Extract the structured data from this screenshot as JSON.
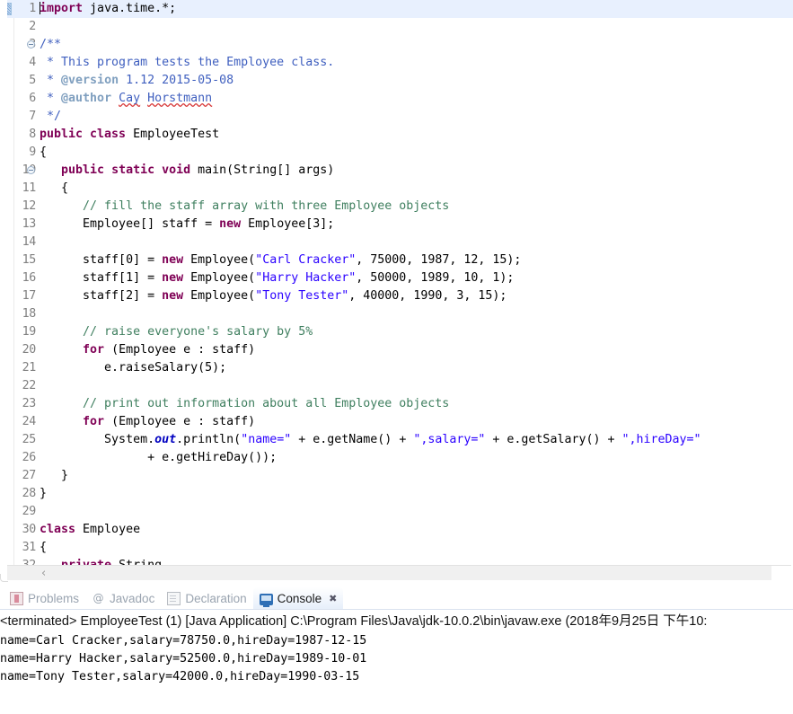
{
  "editor": {
    "name": "java-source-editor",
    "current_line": 1,
    "caret_line": 1,
    "fold_lines": [
      3,
      10
    ],
    "scrollbar": {
      "left_arrow_glyph": "‹"
    },
    "lines": [
      {
        "n": 1,
        "tokens": [
          {
            "t": "caret",
            "v": ""
          },
          {
            "t": "kw",
            "v": "import"
          },
          {
            "t": "plain",
            "v": " java.time.*;"
          }
        ]
      },
      {
        "n": 2,
        "tokens": []
      },
      {
        "n": 3,
        "tokens": [
          {
            "t": "jdoc",
            "v": "/**"
          }
        ]
      },
      {
        "n": 4,
        "tokens": [
          {
            "t": "jdoc",
            "v": " * This program tests the Employee class."
          }
        ]
      },
      {
        "n": 5,
        "tokens": [
          {
            "t": "jdoc",
            "v": " * "
          },
          {
            "t": "jtag",
            "v": "@version"
          },
          {
            "t": "jdoc",
            "v": " 1.12 2015-05-08"
          }
        ]
      },
      {
        "n": 6,
        "tokens": [
          {
            "t": "jdoc",
            "v": " * "
          },
          {
            "t": "jtag",
            "v": "@author"
          },
          {
            "t": "jdoc",
            "v": " "
          },
          {
            "t": "jdoc spell",
            "v": "Cay"
          },
          {
            "t": "jdoc",
            "v": " "
          },
          {
            "t": "jdoc spell",
            "v": "Horstmann"
          }
        ]
      },
      {
        "n": 7,
        "tokens": [
          {
            "t": "jdoc",
            "v": " */"
          }
        ]
      },
      {
        "n": 8,
        "tokens": [
          {
            "t": "kw",
            "v": "public class"
          },
          {
            "t": "plain",
            "v": " EmployeeTest"
          }
        ]
      },
      {
        "n": 9,
        "tokens": [
          {
            "t": "plain",
            "v": "{"
          }
        ]
      },
      {
        "n": 10,
        "tokens": [
          {
            "t": "plain",
            "v": "   "
          },
          {
            "t": "kw",
            "v": "public static void"
          },
          {
            "t": "plain",
            "v": " main(String[] args)"
          }
        ]
      },
      {
        "n": 11,
        "tokens": [
          {
            "t": "plain",
            "v": "   {"
          }
        ]
      },
      {
        "n": 12,
        "tokens": [
          {
            "t": "cmt",
            "v": "      // fill the staff array with three Employee objects"
          }
        ]
      },
      {
        "n": 13,
        "tokens": [
          {
            "t": "plain",
            "v": "      Employee[] staff = "
          },
          {
            "t": "kw",
            "v": "new"
          },
          {
            "t": "plain",
            "v": " Employee[3];"
          }
        ]
      },
      {
        "n": 14,
        "tokens": []
      },
      {
        "n": 15,
        "tokens": [
          {
            "t": "plain",
            "v": "      staff[0] = "
          },
          {
            "t": "kw",
            "v": "new"
          },
          {
            "t": "plain",
            "v": " Employee("
          },
          {
            "t": "str",
            "v": "\"Carl Cracker\""
          },
          {
            "t": "plain",
            "v": ", 75000, 1987, 12, 15);"
          }
        ]
      },
      {
        "n": 16,
        "tokens": [
          {
            "t": "plain",
            "v": "      staff[1] = "
          },
          {
            "t": "kw",
            "v": "new"
          },
          {
            "t": "plain",
            "v": " Employee("
          },
          {
            "t": "str",
            "v": "\"Harry Hacker\""
          },
          {
            "t": "plain",
            "v": ", 50000, 1989, 10, 1);"
          }
        ]
      },
      {
        "n": 17,
        "tokens": [
          {
            "t": "plain",
            "v": "      staff[2] = "
          },
          {
            "t": "kw",
            "v": "new"
          },
          {
            "t": "plain",
            "v": " Employee("
          },
          {
            "t": "str",
            "v": "\"Tony Tester\""
          },
          {
            "t": "plain",
            "v": ", 40000, 1990, 3, 15);"
          }
        ]
      },
      {
        "n": 18,
        "tokens": []
      },
      {
        "n": 19,
        "tokens": [
          {
            "t": "cmt",
            "v": "      // raise everyone's salary by 5%"
          }
        ]
      },
      {
        "n": 20,
        "tokens": [
          {
            "t": "plain",
            "v": "      "
          },
          {
            "t": "kw",
            "v": "for"
          },
          {
            "t": "plain",
            "v": " (Employee e : staff)"
          }
        ]
      },
      {
        "n": 21,
        "tokens": [
          {
            "t": "plain",
            "v": "         e.raiseSalary(5);"
          }
        ]
      },
      {
        "n": 22,
        "tokens": []
      },
      {
        "n": 23,
        "tokens": [
          {
            "t": "cmt",
            "v": "      // print out information about all Employee objects"
          }
        ]
      },
      {
        "n": 24,
        "tokens": [
          {
            "t": "plain",
            "v": "      "
          },
          {
            "t": "kw",
            "v": "for"
          },
          {
            "t": "plain",
            "v": " (Employee e : staff)"
          }
        ]
      },
      {
        "n": 25,
        "tokens": [
          {
            "t": "plain",
            "v": "         System."
          },
          {
            "t": "sfield",
            "v": "out"
          },
          {
            "t": "plain",
            "v": ".println("
          },
          {
            "t": "str",
            "v": "\"name=\""
          },
          {
            "t": "plain",
            "v": " + e.getName() + "
          },
          {
            "t": "str",
            "v": "\",salary=\""
          },
          {
            "t": "plain",
            "v": " + e.getSalary() + "
          },
          {
            "t": "str",
            "v": "\",hireDay=\""
          }
        ]
      },
      {
        "n": 26,
        "tokens": [
          {
            "t": "plain",
            "v": "               + e.getHireDay());"
          }
        ]
      },
      {
        "n": 27,
        "tokens": [
          {
            "t": "plain",
            "v": "   }"
          }
        ]
      },
      {
        "n": 28,
        "tokens": [
          {
            "t": "plain",
            "v": "}"
          }
        ]
      },
      {
        "n": 29,
        "tokens": []
      },
      {
        "n": 30,
        "tokens": [
          {
            "t": "kw",
            "v": "class"
          },
          {
            "t": "plain",
            "v": " Employee"
          }
        ]
      },
      {
        "n": 31,
        "tokens": [
          {
            "t": "plain",
            "v": "{"
          }
        ]
      },
      {
        "n": 32,
        "tokens": [
          {
            "t": "plain",
            "v": "   "
          },
          {
            "t": "kw",
            "v": "private"
          },
          {
            "t": "plain",
            "v": " String"
          }
        ]
      }
    ]
  },
  "bottom_panel": {
    "tabs": [
      {
        "label": "Problems",
        "icon": "problems-icon",
        "active": false,
        "closeable": false
      },
      {
        "label": "Javadoc",
        "icon": "javadoc-icon",
        "active": false,
        "closeable": false
      },
      {
        "label": "Declaration",
        "icon": "declaration-icon",
        "active": false,
        "closeable": false
      },
      {
        "label": "Console",
        "icon": "console-icon",
        "active": true,
        "closeable": true,
        "close_glyph": "✖"
      }
    ],
    "console": {
      "header": "<terminated> EmployeeTest (1) [Java Application] C:\\Program Files\\Java\\jdk-10.0.2\\bin\\javaw.exe (2018年9月25日 下午10:",
      "output": [
        "name=Carl Cracker,salary=78750.0,hireDay=1987-12-15",
        "name=Harry Hacker,salary=52500.0,hireDay=1989-10-01",
        "name=Tony Tester,salary=42000.0,hireDay=1990-03-15"
      ]
    }
  },
  "colors": {
    "keyword": "#7f0055",
    "string": "#2a00ff",
    "comment": "#3f7f5f",
    "javadoc": "#3f5fbf",
    "javadoc_tag": "#7f9fbf",
    "static_field": "#0000c0",
    "current_line_highlight": "#e8f0fe",
    "active_tab_accent": "#2f6fb5"
  }
}
